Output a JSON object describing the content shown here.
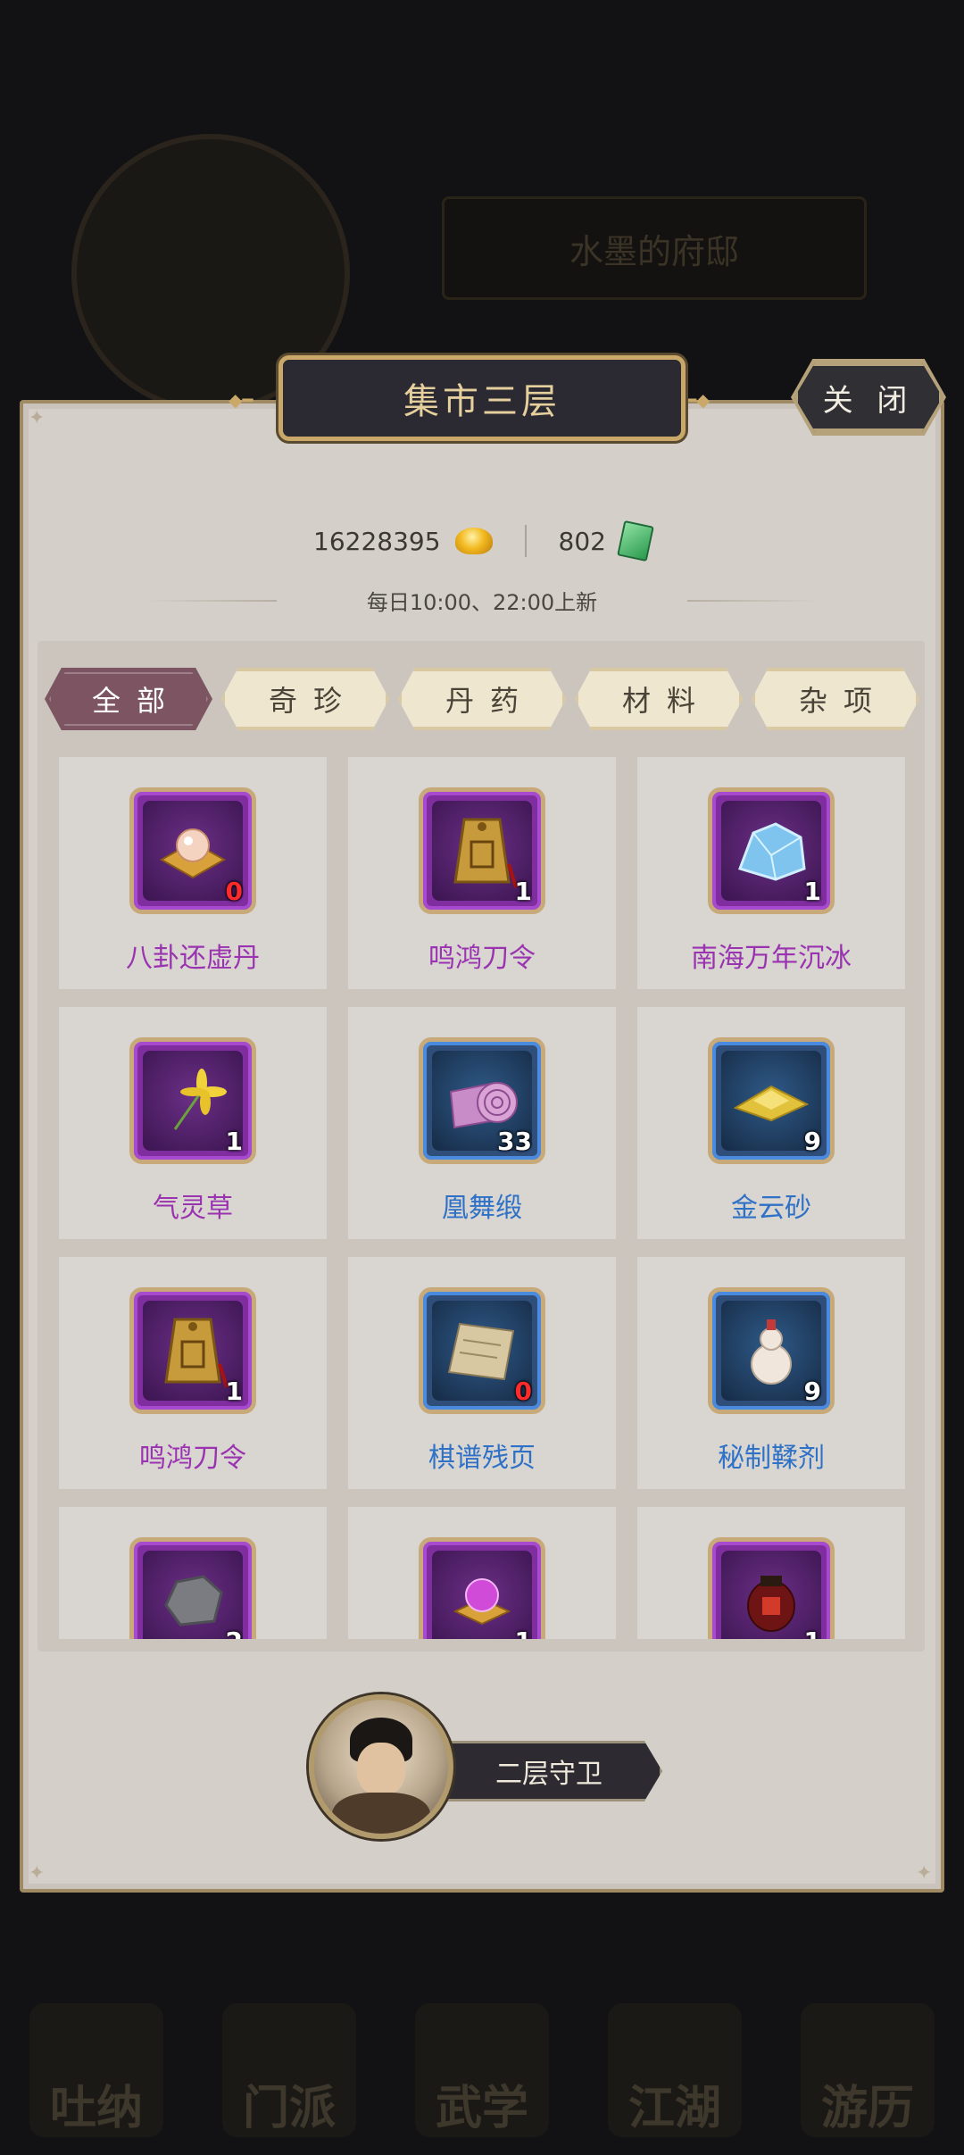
{
  "background": {
    "residence_name": "水墨的府邸",
    "nav_items": [
      "吐纳",
      "门派",
      "武学",
      "江湖",
      "游历"
    ]
  },
  "panel": {
    "title": "集市三层",
    "close_label": "关 闭"
  },
  "currency": {
    "gold": "16228395",
    "jade": "802"
  },
  "refresh_text": "每日10:00、22:00上新",
  "tabs": [
    {
      "label": "全部",
      "active": true
    },
    {
      "label": "奇珍",
      "active": false
    },
    {
      "label": "丹药",
      "active": false
    },
    {
      "label": "材料",
      "active": false
    },
    {
      "label": "杂项",
      "active": false
    }
  ],
  "items": [
    {
      "name": "八卦还虚丹",
      "count": "0",
      "rarity": "purple",
      "icon": "bagua-pill-icon"
    },
    {
      "name": "鸣鸿刀令",
      "count": "1",
      "rarity": "purple",
      "icon": "token-icon"
    },
    {
      "name": "南海万年沉冰",
      "count": "1",
      "rarity": "purple",
      "icon": "ice-icon"
    },
    {
      "name": "气灵草",
      "count": "1",
      "rarity": "purple",
      "icon": "herb-icon"
    },
    {
      "name": "凰舞缎",
      "count": "33",
      "rarity": "blue",
      "icon": "silk-roll-icon"
    },
    {
      "name": "金云砂",
      "count": "9",
      "rarity": "blue",
      "icon": "gold-sand-icon"
    },
    {
      "name": "鸣鸿刀令",
      "count": "1",
      "rarity": "purple",
      "icon": "token-icon"
    },
    {
      "name": "棋谱残页",
      "count": "0",
      "rarity": "blue",
      "icon": "scroll-page-icon"
    },
    {
      "name": "秘制鞣剂",
      "count": "9",
      "rarity": "blue",
      "icon": "gourd-icon"
    },
    {
      "name": "",
      "count": "2",
      "rarity": "purple",
      "icon": "ore-icon"
    },
    {
      "name": "",
      "count": "1",
      "rarity": "purple",
      "icon": "orb-icon"
    },
    {
      "name": "",
      "count": "1",
      "rarity": "purple",
      "icon": "wine-jar-icon"
    }
  ],
  "guard": {
    "label": "二层守卫"
  },
  "colors": {
    "purple_rarity": "#9a33b0",
    "blue_rarity": "#2f71c6",
    "zero_count": "#ff2a2a",
    "active_tab": "#7d5562"
  }
}
